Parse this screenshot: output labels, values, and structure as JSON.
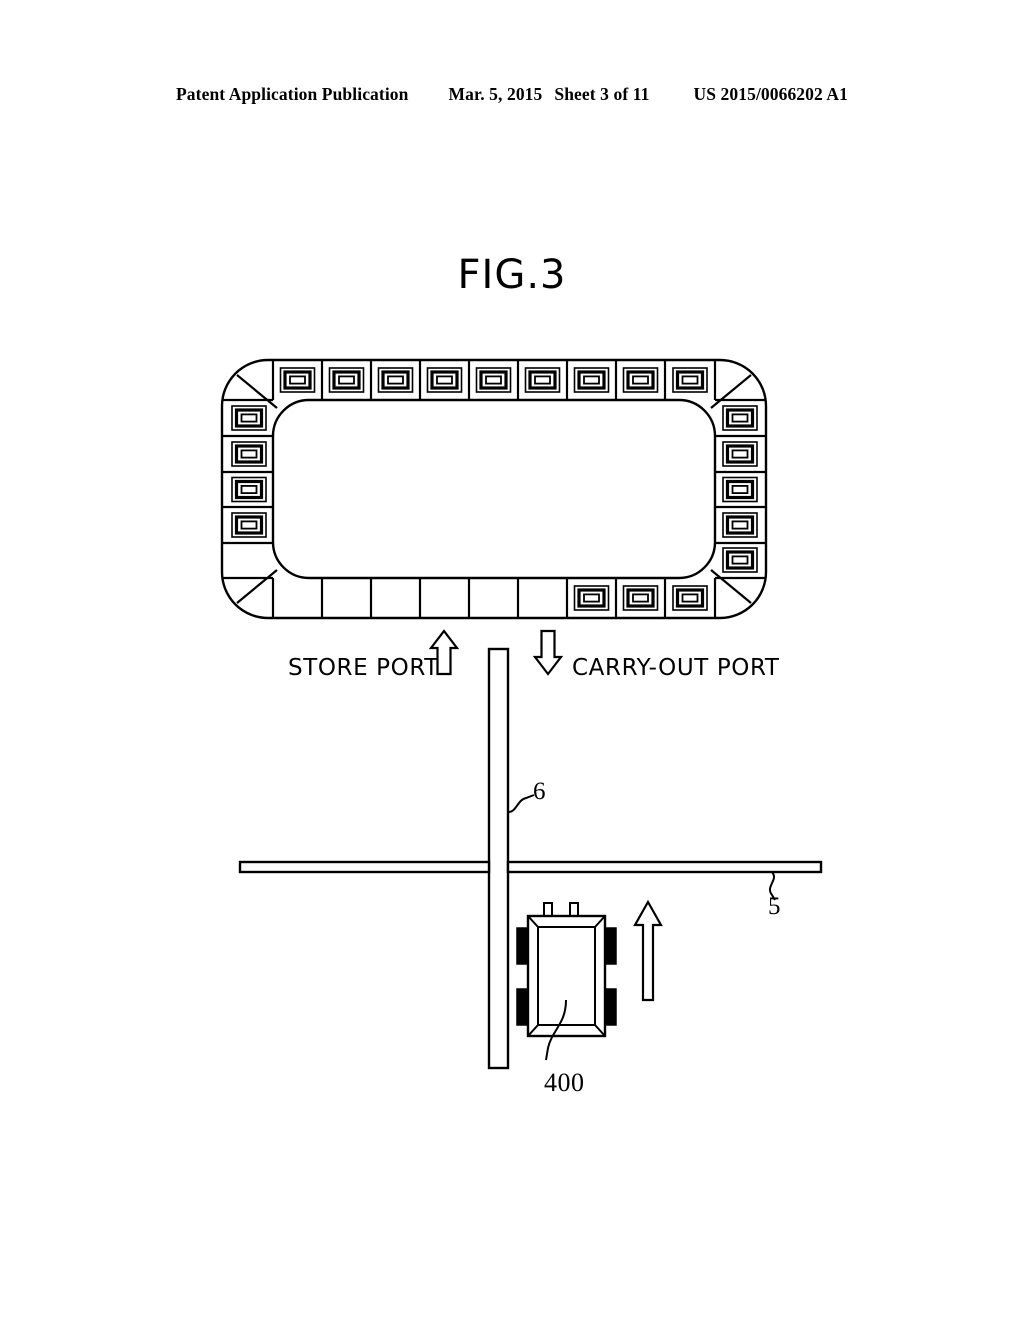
{
  "header": {
    "publication": "Patent Application Publication",
    "date": "Mar. 5, 2015",
    "sheet": "Sheet 3 of 11",
    "patent_number": "US 2015/0066202 A1"
  },
  "figure": {
    "title": "FIG.3",
    "labels": {
      "store_port": "STORE PORT",
      "carry_out_port": "CARRY-OUT PORT",
      "ref_rail_vertical": "6",
      "ref_rail_horizontal": "5",
      "ref_vehicle": "400"
    },
    "track_loop": {
      "description": "rounded-rectangle closed track with bay cells around the perimeter",
      "top_row_cells": 9,
      "top_row_cells_with_icon": 9,
      "left_column_cells": 5,
      "left_column_cells_with_icon": 4,
      "right_column_cells": 5,
      "right_column_cells_with_icon": 5,
      "bottom_row_cells": 9,
      "bottom_row_cells_with_icon": 3,
      "corner_wedges": 4,
      "corner_wedges_with_icon": 0
    },
    "arrows": {
      "store_port_direction": "up",
      "carry_out_port_direction": "down",
      "vehicle_travel_direction": "up"
    },
    "vehicle": {
      "wheels": 4,
      "posts": 2
    }
  },
  "colors": {
    "ink": "#000000",
    "paper": "#ffffff",
    "wheel_fill": "#000000"
  }
}
